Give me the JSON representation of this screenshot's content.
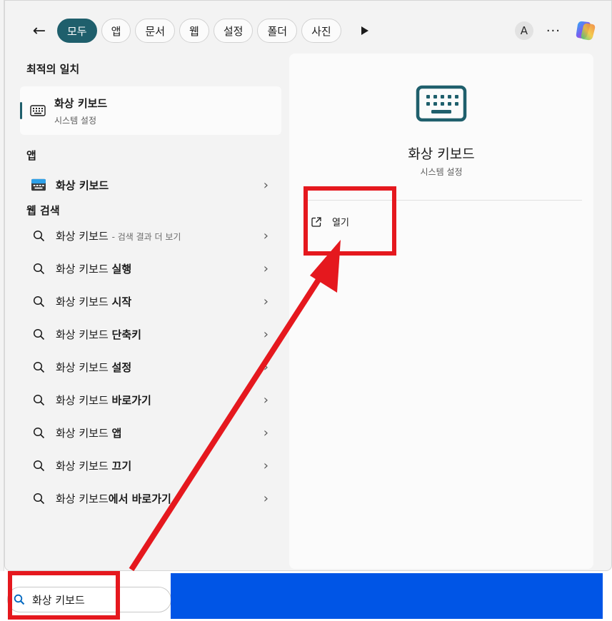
{
  "filter_bar": {
    "chips": [
      "모두",
      "앱",
      "문서",
      "웹",
      "설정",
      "폴더",
      "사진"
    ],
    "active_chip": "모두",
    "avatar_letter": "A",
    "more_label": "···"
  },
  "best_match": {
    "section_title": "최적의 일치",
    "title": "화상 키보드",
    "subtitle": "시스템 설정"
  },
  "apps": {
    "section_title": "앱",
    "items": [
      {
        "label": "화상 키보드"
      }
    ]
  },
  "web_search": {
    "section_title": "웹 검색",
    "first": {
      "label": "화상 키보드",
      "suffix": "- 검색 결과 더 보기"
    },
    "items": [
      {
        "prefix": "화상 키보드 ",
        "bold": "실행"
      },
      {
        "prefix": "화상 키보드 ",
        "bold": "시작"
      },
      {
        "prefix": "화상 키보드 ",
        "bold": "단축키"
      },
      {
        "prefix": "화상 키보드 ",
        "bold": "설정"
      },
      {
        "prefix": "화상 키보드 ",
        "bold": "바로가기"
      },
      {
        "prefix": "화상 키보드 ",
        "bold": "앱"
      },
      {
        "prefix": "화상 키보드 ",
        "bold": "끄기"
      },
      {
        "prefix": "화상 키보드",
        "bold": "에서 바로가기"
      }
    ]
  },
  "preview": {
    "title": "화상 키보드",
    "subtitle": "시스템 설정",
    "open_label": "열기"
  },
  "taskbar": {
    "search_value": "화상 키보드"
  },
  "colors": {
    "accent": "#1f5f6c",
    "annotation_red": "#e5181e",
    "taskbar_blue": "#0055e6"
  }
}
